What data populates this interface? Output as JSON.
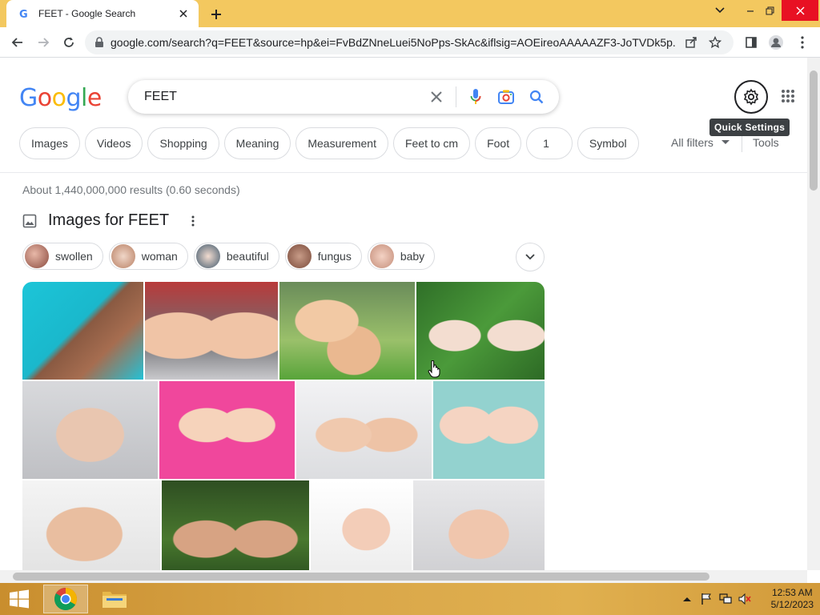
{
  "browser": {
    "tab_title": "FEET - Google Search",
    "url": "google.com/search?q=FEET&source=hp&ei=FvBdZNneLuei5NoPps-SkAc&iflsig=AOEireoAAAAAZF3-JoTVDk5p..."
  },
  "google": {
    "logo_letters": [
      "G",
      "o",
      "o",
      "g",
      "l",
      "e"
    ],
    "logo_colors": [
      "#4285f4",
      "#ea4335",
      "#fbbc05",
      "#4285f4",
      "#34a853",
      "#ea4335"
    ],
    "query": "FEET",
    "quick_settings_tooltip": "Quick Settings"
  },
  "filters": {
    "chips": [
      "Images",
      "Videos",
      "Shopping",
      "Meaning",
      "Measurement",
      "Feet to cm",
      "Foot",
      "1",
      "Symbol"
    ],
    "all_filters": "All filters",
    "tools": "Tools"
  },
  "results": {
    "stats": "About 1,440,000,000 results (0.60 seconds)",
    "images_heading": "Images for FEET",
    "related_chips": [
      "swollen",
      "woman",
      "beautiful",
      "fungus",
      "baby"
    ]
  },
  "taskbar": {
    "time": "12:53 AM",
    "date": "5/12/2023"
  },
  "colors": {
    "tabstrip": "#f3c85f",
    "link_blue": "#4285f4"
  }
}
